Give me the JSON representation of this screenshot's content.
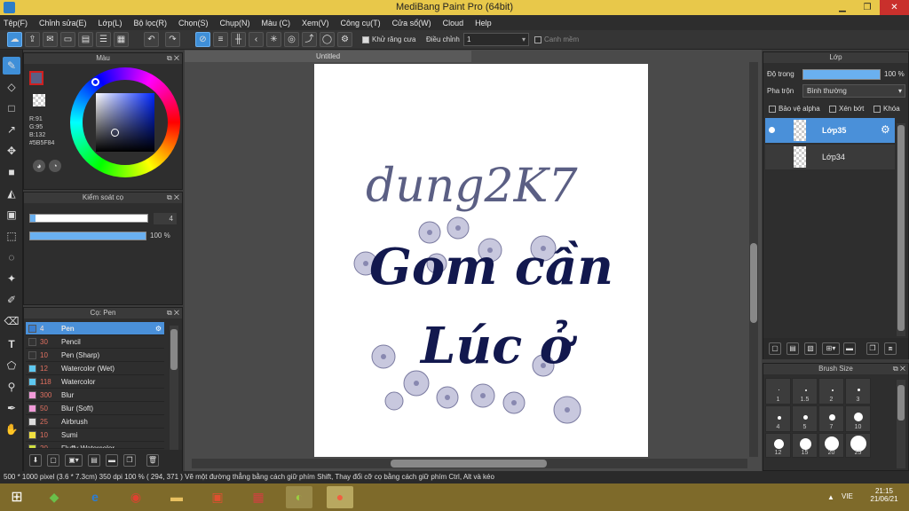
{
  "window": {
    "title": "MediBang Paint Pro (64bit)"
  },
  "menu": [
    "Tệp(F)",
    "Chỉnh sửa(E)",
    "Lớp(L)",
    "Bộ lọc(R)",
    "Chọn(S)",
    "Chụp(N)",
    "Màu (C)",
    "Xem(V)",
    "Công cụ(T)",
    "Cửa sổ(W)",
    "Cloud",
    "Help"
  ],
  "toolbar": {
    "antialias_label": "Khử răng cưa",
    "adjust_label": "Điều chỉnh",
    "adjust_value": "1",
    "smooth_label": "Canh mềm"
  },
  "color_panel": {
    "title": "Màu",
    "r": "R:91",
    "g": "G:95",
    "b": "B:132",
    "hex": "#5B5F84",
    "fg_color": "#5B5F84"
  },
  "brush_control": {
    "title": "Kiểm soát cọ",
    "size": "4",
    "opacity": "100 %"
  },
  "brush_panel": {
    "title": "Cọ: Pen",
    "items": [
      {
        "size": "4",
        "name": "Pen",
        "color": "#3c7fd0"
      },
      {
        "size": "30",
        "name": "Pencil",
        "color": "#333333"
      },
      {
        "size": "10",
        "name": "Pen (Sharp)",
        "color": "#333333"
      },
      {
        "size": "12",
        "name": "Watercolor (Wet)",
        "color": "#5ec8f0"
      },
      {
        "size": "118",
        "name": "Watercolor",
        "color": "#5ec8f0"
      },
      {
        "size": "300",
        "name": "Blur",
        "color": "#f09ad8"
      },
      {
        "size": "50",
        "name": "Blur (Soft)",
        "color": "#f09ad8"
      },
      {
        "size": "25",
        "name": "Airbrush",
        "color": "#dddddd"
      },
      {
        "size": "10",
        "name": "Sumi",
        "color": "#f0e040"
      },
      {
        "size": "20",
        "name": "Fluffy Watercolor",
        "color": "#d0e040"
      }
    ]
  },
  "canvas": {
    "tab": "Untitled",
    "line1": "dung2K7",
    "line2": "Gom cần",
    "line3": "Lúc ở"
  },
  "layer_panel": {
    "title": "Lớp",
    "opacity_label": "Độ trong",
    "opacity_value": "100 %",
    "blend_label": "Pha trộn",
    "blend_value": "Bình thường",
    "protect_alpha": "Bảo vệ alpha",
    "clipping": "Xén bớt",
    "lock": "Khóa",
    "layers": [
      "Lớp35",
      "Lớp34"
    ]
  },
  "brush_size_panel": {
    "title": "Brush Size",
    "labels": [
      "1",
      "1.5",
      "2",
      "3",
      "4",
      "5",
      "7",
      "10",
      "12",
      "15",
      "20",
      "25"
    ]
  },
  "status": {
    "text": "500 * 1000 pixel   (3.6 * 7.3cm)   350 dpi   100 %   ( 294, 371 )   Vẽ một đường thẳng bằng cách giữ phím Shift, Thay đổi cỡ cọ bằng cách giữ phím Ctrl, Alt và kéo"
  },
  "taskbar": {
    "lang": "VIE",
    "time": "21:15",
    "date": "21/06/21"
  }
}
